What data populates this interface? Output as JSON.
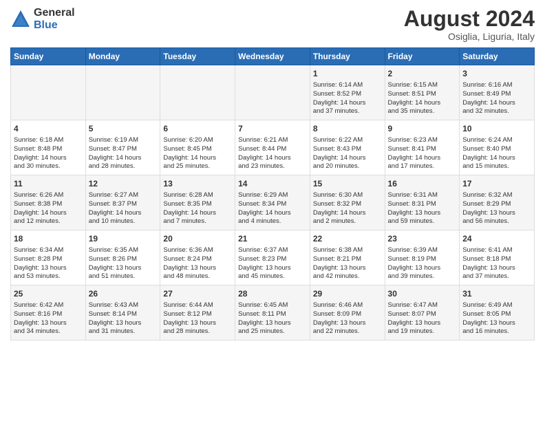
{
  "header": {
    "logo_general": "General",
    "logo_blue": "Blue",
    "month_year": "August 2024",
    "location": "Osiglia, Liguria, Italy"
  },
  "weekdays": [
    "Sunday",
    "Monday",
    "Tuesday",
    "Wednesday",
    "Thursday",
    "Friday",
    "Saturday"
  ],
  "weeks": [
    [
      {
        "day": "",
        "info": ""
      },
      {
        "day": "",
        "info": ""
      },
      {
        "day": "",
        "info": ""
      },
      {
        "day": "",
        "info": ""
      },
      {
        "day": "1",
        "info": "Sunrise: 6:14 AM\nSunset: 8:52 PM\nDaylight: 14 hours\nand 37 minutes."
      },
      {
        "day": "2",
        "info": "Sunrise: 6:15 AM\nSunset: 8:51 PM\nDaylight: 14 hours\nand 35 minutes."
      },
      {
        "day": "3",
        "info": "Sunrise: 6:16 AM\nSunset: 8:49 PM\nDaylight: 14 hours\nand 32 minutes."
      }
    ],
    [
      {
        "day": "4",
        "info": "Sunrise: 6:18 AM\nSunset: 8:48 PM\nDaylight: 14 hours\nand 30 minutes."
      },
      {
        "day": "5",
        "info": "Sunrise: 6:19 AM\nSunset: 8:47 PM\nDaylight: 14 hours\nand 28 minutes."
      },
      {
        "day": "6",
        "info": "Sunrise: 6:20 AM\nSunset: 8:45 PM\nDaylight: 14 hours\nand 25 minutes."
      },
      {
        "day": "7",
        "info": "Sunrise: 6:21 AM\nSunset: 8:44 PM\nDaylight: 14 hours\nand 23 minutes."
      },
      {
        "day": "8",
        "info": "Sunrise: 6:22 AM\nSunset: 8:43 PM\nDaylight: 14 hours\nand 20 minutes."
      },
      {
        "day": "9",
        "info": "Sunrise: 6:23 AM\nSunset: 8:41 PM\nDaylight: 14 hours\nand 17 minutes."
      },
      {
        "day": "10",
        "info": "Sunrise: 6:24 AM\nSunset: 8:40 PM\nDaylight: 14 hours\nand 15 minutes."
      }
    ],
    [
      {
        "day": "11",
        "info": "Sunrise: 6:26 AM\nSunset: 8:38 PM\nDaylight: 14 hours\nand 12 minutes."
      },
      {
        "day": "12",
        "info": "Sunrise: 6:27 AM\nSunset: 8:37 PM\nDaylight: 14 hours\nand 10 minutes."
      },
      {
        "day": "13",
        "info": "Sunrise: 6:28 AM\nSunset: 8:35 PM\nDaylight: 14 hours\nand 7 minutes."
      },
      {
        "day": "14",
        "info": "Sunrise: 6:29 AM\nSunset: 8:34 PM\nDaylight: 14 hours\nand 4 minutes."
      },
      {
        "day": "15",
        "info": "Sunrise: 6:30 AM\nSunset: 8:32 PM\nDaylight: 14 hours\nand 2 minutes."
      },
      {
        "day": "16",
        "info": "Sunrise: 6:31 AM\nSunset: 8:31 PM\nDaylight: 13 hours\nand 59 minutes."
      },
      {
        "day": "17",
        "info": "Sunrise: 6:32 AM\nSunset: 8:29 PM\nDaylight: 13 hours\nand 56 minutes."
      }
    ],
    [
      {
        "day": "18",
        "info": "Sunrise: 6:34 AM\nSunset: 8:28 PM\nDaylight: 13 hours\nand 53 minutes."
      },
      {
        "day": "19",
        "info": "Sunrise: 6:35 AM\nSunset: 8:26 PM\nDaylight: 13 hours\nand 51 minutes."
      },
      {
        "day": "20",
        "info": "Sunrise: 6:36 AM\nSunset: 8:24 PM\nDaylight: 13 hours\nand 48 minutes."
      },
      {
        "day": "21",
        "info": "Sunrise: 6:37 AM\nSunset: 8:23 PM\nDaylight: 13 hours\nand 45 minutes."
      },
      {
        "day": "22",
        "info": "Sunrise: 6:38 AM\nSunset: 8:21 PM\nDaylight: 13 hours\nand 42 minutes."
      },
      {
        "day": "23",
        "info": "Sunrise: 6:39 AM\nSunset: 8:19 PM\nDaylight: 13 hours\nand 39 minutes."
      },
      {
        "day": "24",
        "info": "Sunrise: 6:41 AM\nSunset: 8:18 PM\nDaylight: 13 hours\nand 37 minutes."
      }
    ],
    [
      {
        "day": "25",
        "info": "Sunrise: 6:42 AM\nSunset: 8:16 PM\nDaylight: 13 hours\nand 34 minutes."
      },
      {
        "day": "26",
        "info": "Sunrise: 6:43 AM\nSunset: 8:14 PM\nDaylight: 13 hours\nand 31 minutes."
      },
      {
        "day": "27",
        "info": "Sunrise: 6:44 AM\nSunset: 8:12 PM\nDaylight: 13 hours\nand 28 minutes."
      },
      {
        "day": "28",
        "info": "Sunrise: 6:45 AM\nSunset: 8:11 PM\nDaylight: 13 hours\nand 25 minutes."
      },
      {
        "day": "29",
        "info": "Sunrise: 6:46 AM\nSunset: 8:09 PM\nDaylight: 13 hours\nand 22 minutes."
      },
      {
        "day": "30",
        "info": "Sunrise: 6:47 AM\nSunset: 8:07 PM\nDaylight: 13 hours\nand 19 minutes."
      },
      {
        "day": "31",
        "info": "Sunrise: 6:49 AM\nSunset: 8:05 PM\nDaylight: 13 hours\nand 16 minutes."
      }
    ]
  ]
}
